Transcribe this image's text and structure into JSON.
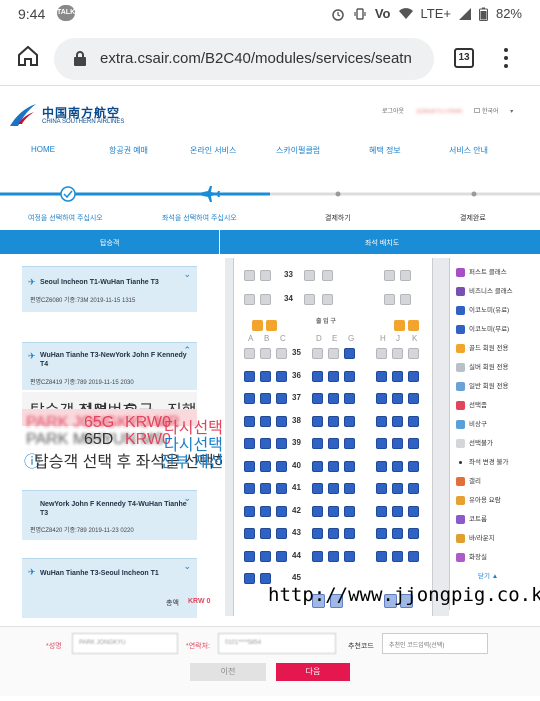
{
  "status": {
    "time": "9:44",
    "talk": "TALK",
    "network": "LTE+",
    "battery": "82%"
  },
  "browser": {
    "url": "extra.csair.com/B2C40/modules/services/seatn",
    "tab_count": "13"
  },
  "brand": {
    "name_cn": "中国南方航空",
    "name_en": "CHINA SOUTHERN AIRLINES"
  },
  "toplinks": {
    "logout": "로그아웃",
    "user": "JONGKYU PARK",
    "language": "한국어"
  },
  "nav": [
    "HOME",
    "항공권 예매",
    "온라인 서비스",
    "스카이펄클럽",
    "혜택 정보",
    "서비스 안내"
  ],
  "steps": [
    "여정을 선택하여 주십시오",
    "좌석을 선택하여 주십시오",
    "결제하기",
    "결제완료"
  ],
  "tabs": {
    "passenger": "탑승객",
    "seat": "좌석 배치도"
  },
  "flights": [
    {
      "title": "Seoul Incheon T1-WuHan Tianhe T3",
      "meta": "편명CZ6080  기종:73M        2019-11-15 1315"
    },
    {
      "title": "WuHan Tianhe T3-NewYork John F Kennedy T4",
      "meta": "편명CZ8419  기종:789        2019-11-15 2030"
    },
    {
      "title": "NewYork John F Kennedy T4-WuHan Tianhe T3",
      "meta": "편명CZ8420  기종:789        2019-11-23 0220"
    },
    {
      "title": "WuHan Tianhe T3-Seoul Incheon T1",
      "meta": ""
    }
  ],
  "ptable": {
    "headers": [
      "탑승객 성명",
      "좌석번호",
      "요금",
      "진행"
    ],
    "rows": [
      {
        "name": "PARK JONGKYU MR",
        "seat": "65G",
        "fee": "KRW0",
        "action": "다시선택"
      },
      {
        "name": "PARK MIHYUN MS",
        "seat": "65D",
        "fee": "KRW0",
        "action": "다시선택"
      }
    ],
    "note": "탑승객 선택 후 좌석을 선택하여 주십시오",
    "reset": "전부 재선택"
  },
  "seatmap": {
    "columns_left": [
      "A",
      "B",
      "C"
    ],
    "columns_mid": [
      "D",
      "E",
      "G"
    ],
    "columns_right": [
      "H",
      "J",
      "K"
    ],
    "aisle_label": "출 입 구",
    "rows": [
      "33",
      "34",
      "35",
      "36",
      "37",
      "38",
      "39",
      "40",
      "41",
      "42",
      "43",
      "44",
      "45"
    ]
  },
  "legend": [
    "퍼스트 클래스",
    "비즈니스 클래스",
    "이코노미(유료)",
    "이코노미(무료)",
    "골드 회원 전용",
    "실버 회원 전용",
    "일반 회원 전용",
    "선택좀",
    "비상구",
    "선택불가",
    "좌석 변경 불가",
    "갤리",
    "유아용 요람",
    "코트룸",
    "바/라운지",
    "화장실",
    "닫기"
  ],
  "total": {
    "label": "총액",
    "value": "KRW 0"
  },
  "form": {
    "name_label": "*성명",
    "name_value": "PARK JONGKYU",
    "phone_label": "*연락처:",
    "phone_value": "0101****5854",
    "code_label": "추천코드",
    "code_placeholder": "추천인 코드입력(선택)",
    "prev": "이전",
    "next": "다음"
  },
  "watermark": "http://www.jjongpig.co.kr"
}
